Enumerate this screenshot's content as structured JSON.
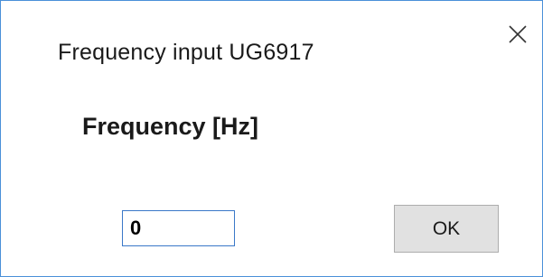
{
  "dialog": {
    "title": "Frequency input UG6917",
    "close_icon": "close-icon"
  },
  "form": {
    "label": "Frequency [Hz]",
    "input_value": "0"
  },
  "buttons": {
    "ok_label": "OK"
  },
  "colors": {
    "border_accent": "#4a90d9",
    "input_border": "#3a78c8",
    "button_bg": "#e1e1e1"
  }
}
